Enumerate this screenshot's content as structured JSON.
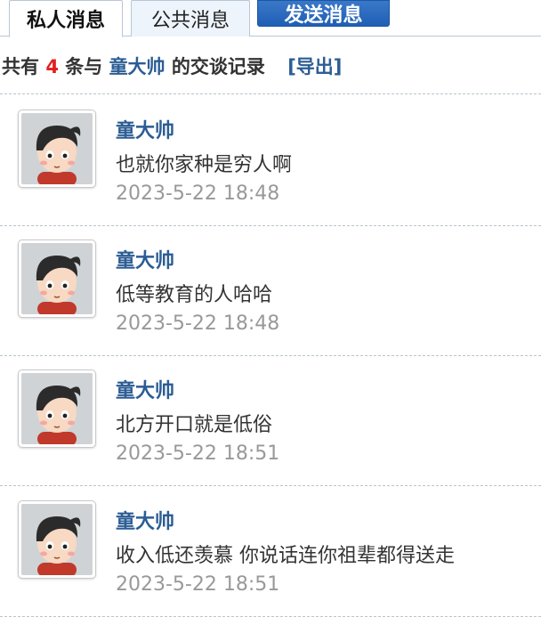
{
  "tabs": {
    "private": "私人消息",
    "public": "公共消息",
    "send": "发送消息"
  },
  "summary": {
    "prefix": "共有",
    "count": "4",
    "middle": "条与",
    "name": "童大帅",
    "suffix": "的交谈记录",
    "export": "[导出]"
  },
  "messages": [
    {
      "sender": "童大帅",
      "text": "也就你家种是穷人啊",
      "time": "2023-5-22 18:48",
      "avatar_icon": "cartoon-boy-avatar"
    },
    {
      "sender": "童大帅",
      "text": "低等教育的人哈哈",
      "time": "2023-5-22 18:48",
      "avatar_icon": "cartoon-boy-avatar"
    },
    {
      "sender": "童大帅",
      "text": "北方开口就是低俗",
      "time": "2023-5-22 18:51",
      "avatar_icon": "cartoon-boy-avatar"
    },
    {
      "sender": "童大帅",
      "text": "收入低还羡慕 你说话连你祖辈都得送走",
      "time": "2023-5-22 18:51",
      "avatar_icon": "cartoon-boy-avatar"
    }
  ],
  "colors": {
    "link": "#2c5d94",
    "count": "#e02020",
    "time": "#999999",
    "send_button": "#2867bd"
  }
}
